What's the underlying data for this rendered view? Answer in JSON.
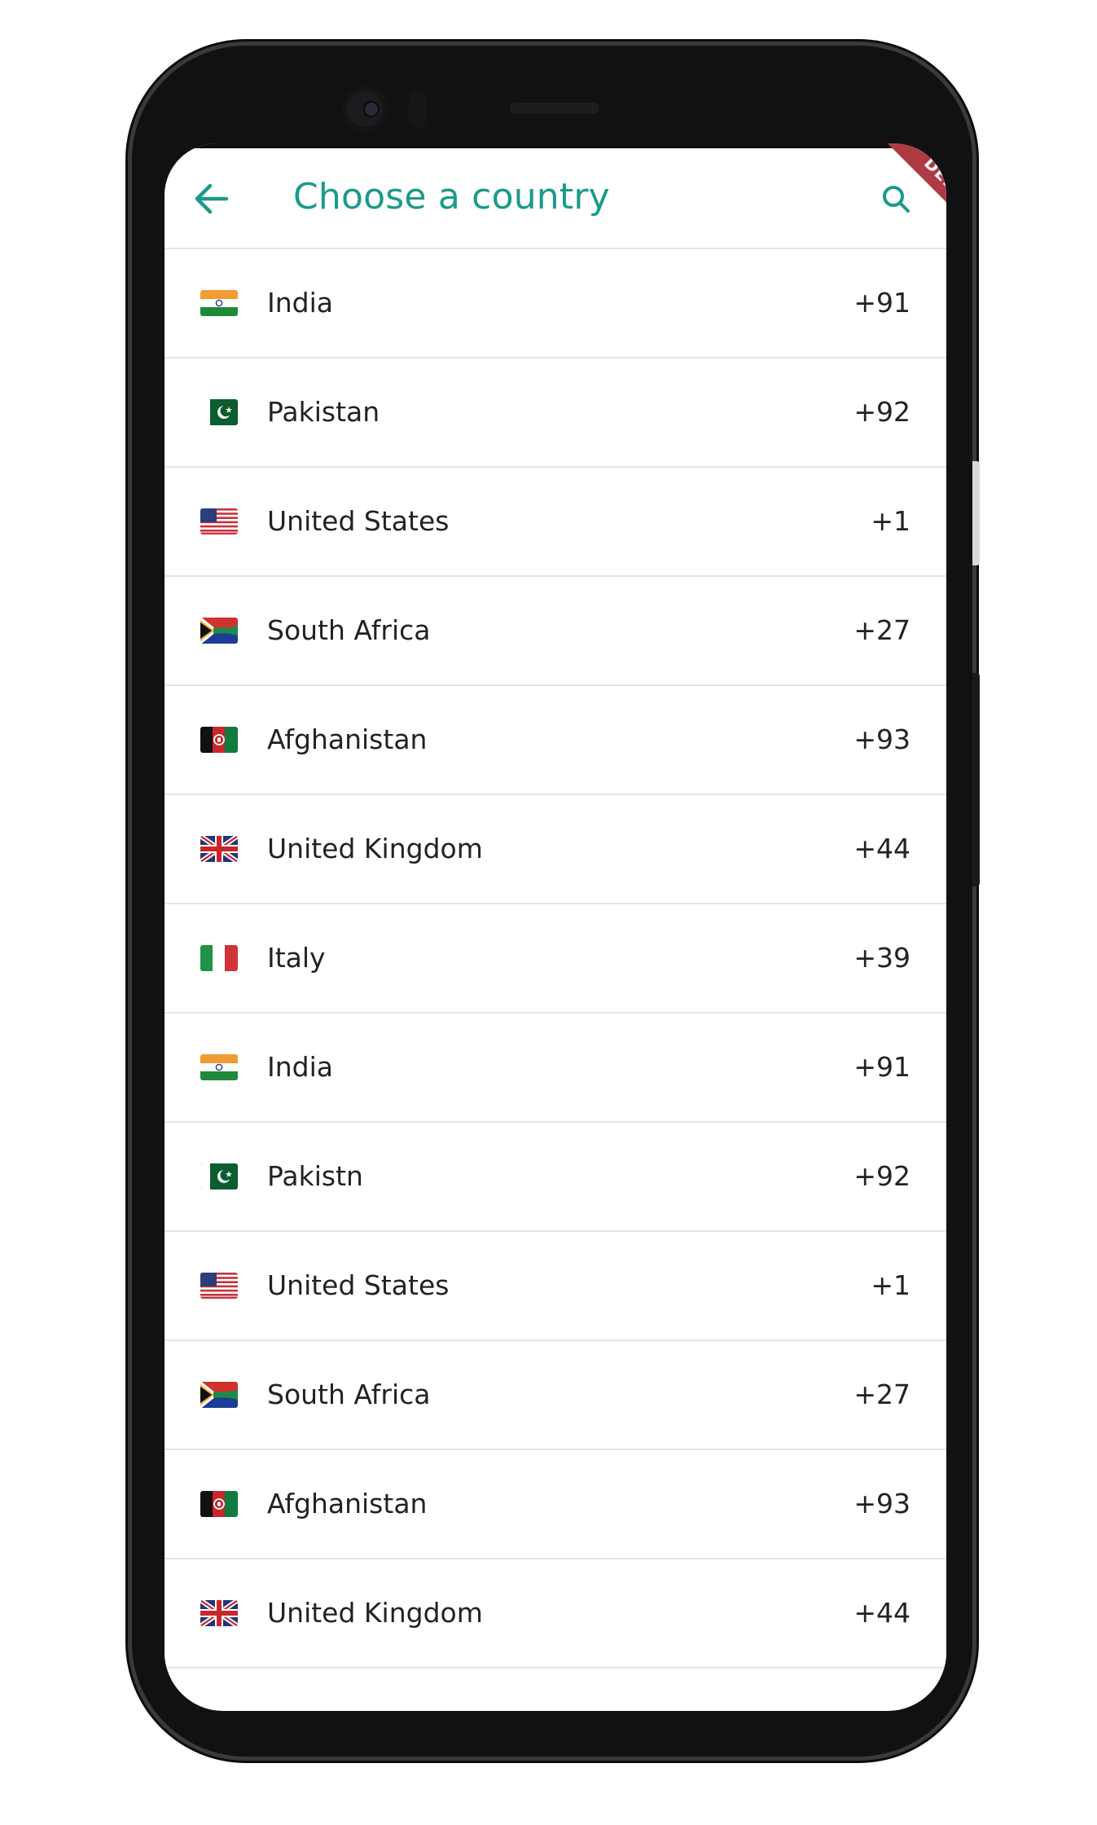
{
  "app_bar": {
    "title": "Choose a country",
    "back_icon": "arrow-left-icon",
    "search_icon": "search-icon",
    "accent_color": "#1a9a8a"
  },
  "debug_banner": {
    "label": "DEBUG",
    "color": "#b03a44"
  },
  "countries": [
    {
      "name": "India",
      "code": "+91",
      "flag": "india-flag-icon"
    },
    {
      "name": "Pakistan",
      "code": "+92",
      "flag": "pakistan-flag-icon"
    },
    {
      "name": "United States",
      "code": "+1",
      "flag": "usa-flag-icon"
    },
    {
      "name": "South Africa",
      "code": "+27",
      "flag": "south-africa-flag-icon"
    },
    {
      "name": "Afghanistan",
      "code": "+93",
      "flag": "afghanistan-flag-icon"
    },
    {
      "name": "United Kingdom",
      "code": "+44",
      "flag": "uk-flag-icon"
    },
    {
      "name": "Italy",
      "code": "+39",
      "flag": "italy-flag-icon"
    },
    {
      "name": "India",
      "code": "+91",
      "flag": "india-flag-icon"
    },
    {
      "name": "Pakistn",
      "code": "+92",
      "flag": "pakistan-flag-icon"
    },
    {
      "name": "United States",
      "code": "+1",
      "flag": "usa-flag-icon"
    },
    {
      "name": "South Africa",
      "code": "+27",
      "flag": "south-africa-flag-icon"
    },
    {
      "name": "Afghanistan",
      "code": "+93",
      "flag": "afghanistan-flag-icon"
    },
    {
      "name": "United Kingdom",
      "code": "+44",
      "flag": "uk-flag-icon"
    }
  ]
}
